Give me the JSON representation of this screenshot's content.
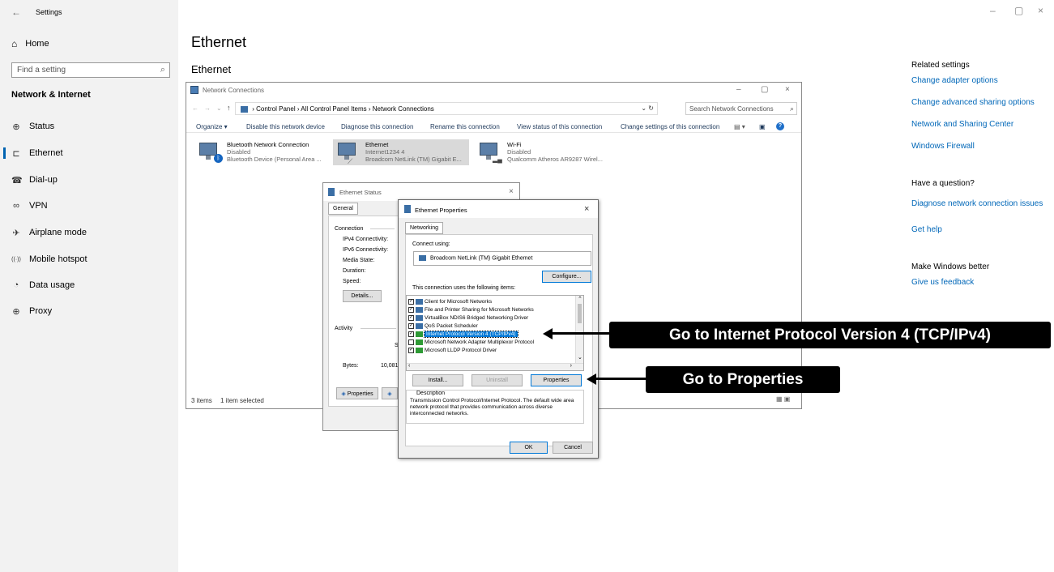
{
  "app": {
    "title": "Settings",
    "back_glyph": "←"
  },
  "window_controls": {
    "minimize": "–",
    "maximize": "▢",
    "close": "×"
  },
  "sidebar": {
    "home": "Home",
    "search_placeholder": "Find a setting",
    "section": "Network & Internet",
    "items": [
      {
        "label": "Status",
        "icon": "globe-status-icon",
        "glyph": "⊕"
      },
      {
        "label": "Ethernet",
        "icon": "ethernet-icon",
        "glyph": "⊏"
      },
      {
        "label": "Dial-up",
        "icon": "dialup-icon",
        "glyph": "☎"
      },
      {
        "label": "VPN",
        "icon": "vpn-icon",
        "glyph": "∞"
      },
      {
        "label": "Airplane mode",
        "icon": "airplane-icon",
        "glyph": "✈"
      },
      {
        "label": "Mobile hotspot",
        "icon": "hotspot-icon",
        "glyph": "((·))"
      },
      {
        "label": "Data usage",
        "icon": "data-usage-icon",
        "glyph": "◔"
      },
      {
        "label": "Proxy",
        "icon": "proxy-globe-icon",
        "glyph": "⊕"
      }
    ]
  },
  "main": {
    "page_title": "Ethernet",
    "section_title": "Ethernet"
  },
  "related": {
    "heading": "Related settings",
    "links": [
      "Change adapter options",
      "Change advanced sharing options",
      "Network and Sharing Center",
      "Windows Firewall"
    ],
    "question_heading": "Have a question?",
    "question_links": [
      "Diagnose network connection issues",
      "Get help"
    ],
    "better_heading": "Make Windows better",
    "better_links": [
      "Give us feedback"
    ]
  },
  "netconn": {
    "title": "Network Connections",
    "breadcrumb": "› Control Panel › All Control Panel Items › Network Connections",
    "search_placeholder": "Search Network Connections",
    "commands": [
      "Organize ▾",
      "Disable this network device",
      "Diagnose this connection",
      "Rename this connection",
      "View status of this connection",
      "Change settings of this connection"
    ],
    "adapters": [
      {
        "name": "Bluetooth Network Connection",
        "status": "Disabled",
        "device": "Bluetooth Device (Personal Area ..."
      },
      {
        "name": "Ethernet",
        "status": "Internet1234 4",
        "device": "Broadcom NetLink (TM) Gigabit E..."
      },
      {
        "name": "Wi-Fi",
        "status": "Disabled",
        "device": "Qualcomm Atheros AR9287 Wirel..."
      }
    ],
    "status_items": "3 items",
    "status_selected": "1 item selected"
  },
  "eth_status": {
    "title": "Ethernet Status",
    "tab": "General",
    "connection": "Connection",
    "rows": [
      "IPv4 Connectivity:",
      "IPv6 Connectivity:",
      "Media State:",
      "Duration:",
      "Speed:"
    ],
    "details_btn": "Details...",
    "activity": "Activity",
    "sent_partial": "Se",
    "bytes_label": "Bytes:",
    "bytes_value": "10,081",
    "properties_btn": "Properties"
  },
  "eth_props": {
    "title": "Ethernet Properties",
    "tab": "Networking",
    "connect_using": "Connect using:",
    "adapter": "Broadcom NetLink (TM) Gigabit Ethemet",
    "configure_btn": "Configure...",
    "items_label": "This connection uses the following items:",
    "items": [
      {
        "label": "Client for Microsoft Networks",
        "checked": true
      },
      {
        "label": "File and Printer Sharing for Microsoft Networks",
        "checked": true
      },
      {
        "label": "VirtualBox NDIS6 Bridged Networking Driver",
        "checked": true
      },
      {
        "label": "QoS Packet Scheduler",
        "checked": true
      },
      {
        "label": "Internet Protocol Version 4 (TCP/IPv4)",
        "checked": true,
        "selected": true
      },
      {
        "label": "Microsoft Network Adapter Multiplexor Protocol",
        "checked": false
      },
      {
        "label": "Microsoft LLDP Protocol Driver",
        "checked": true
      }
    ],
    "install_btn": "Install...",
    "uninstall_btn": "Uninstall",
    "properties_btn": "Properties",
    "description_label": "Description",
    "description": "Transmission Control Protocol/Internet Protocol. The default wide area network protocol that provides communication across diverse interconnected networks.",
    "ok_btn": "OK",
    "cancel_btn": "Cancel"
  },
  "callouts": {
    "ipv4": "Go to Internet Protocol Version 4 (TCP/IPv4)",
    "properties": "Go to Properties"
  }
}
